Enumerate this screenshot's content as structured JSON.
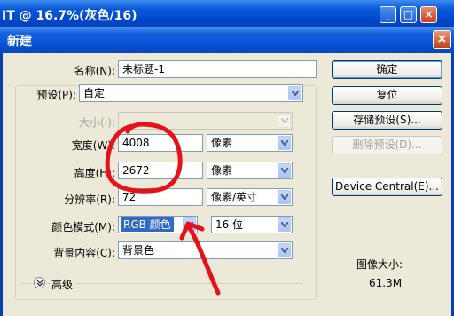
{
  "background_window": {
    "title": "IT @ 16.7%(灰色/16)"
  },
  "dialog": {
    "title": "新建",
    "name": {
      "label": "名称(N):",
      "value": "未标题-1"
    },
    "preset": {
      "label": "预设(P):",
      "value": "自定"
    },
    "size": {
      "label": "大小(I):",
      "value": ""
    },
    "width": {
      "label": "宽度(W):",
      "value": "4008",
      "unit": "像素"
    },
    "height": {
      "label": "高度(H):",
      "value": "2672",
      "unit": "像素"
    },
    "resolution": {
      "label": "分辨率(R):",
      "value": "72",
      "unit": "像素/英寸"
    },
    "color_mode": {
      "label": "颜色模式(M):",
      "value": "RGB 颜色",
      "depth": "16 位"
    },
    "background": {
      "label": "背景内容(C):",
      "value": "背景色"
    },
    "advanced": {
      "label": "高级"
    },
    "buttons": {
      "ok": "确定",
      "reset": "复位",
      "save_preset": "存储预设(S)...",
      "delete_preset": "删除预设(D)...",
      "device_central": "Device Central(E)..."
    },
    "image_size": {
      "label": "图像大小:",
      "value": "61.3M"
    }
  },
  "annotation": {
    "color": "#e8101a"
  }
}
